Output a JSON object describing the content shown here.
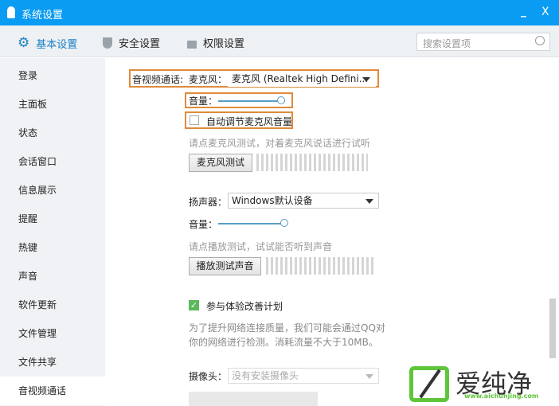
{
  "window": {
    "title": "系统设置",
    "minimize": "_",
    "close": "X"
  },
  "toolbar": {
    "tabs": [
      {
        "label": "基本设置",
        "icon": "gear-icon"
      },
      {
        "label": "安全设置",
        "icon": "shield-icon"
      },
      {
        "label": "权限设置",
        "icon": "lock-icon"
      }
    ],
    "search_placeholder": "搜索设置项"
  },
  "sidebar": {
    "items": [
      "登录",
      "主面板",
      "状态",
      "会话窗口",
      "信息展示",
      "提醒",
      "热键",
      "声音",
      "软件更新",
      "文件管理",
      "文件共享",
      "音视频通话"
    ],
    "selected": "音视频通话"
  },
  "content": {
    "section_label": "音视频通话:",
    "mic_label": "麦克风：",
    "mic_value": "麦克风 (Realtek High Defini...",
    "mic_volume_label": "音量：",
    "mic_volume": 0.85,
    "auto_adjust_label": "自动调节麦克风音量",
    "auto_adjust_checked": false,
    "mic_hint": "请点麦克风测试，对着麦克风说话进行试听",
    "mic_test_button": "麦克风测试",
    "speaker_label": "扬声器：",
    "speaker_value": "Windows默认设备",
    "speaker_volume_label": "音量：",
    "speaker_volume": 1.0,
    "speaker_hint": "请点播放测试，试试能否听到声音",
    "speaker_test_button": "播放测试声音",
    "improve_label": "参与体验改善计划",
    "improve_checked": true,
    "improve_desc1": "为了提升网络连接质量，我们可能会通过QQ对",
    "improve_desc2": "你的网络进行检测。消耗流量不大于10MB。",
    "camera_label": "摄像头：",
    "camera_value": "没有安装摄像头"
  },
  "watermark": {
    "text": "爱纯净",
    "url": "www.aichunjing.com"
  },
  "colors": {
    "titlebar": "#0a9bf2",
    "highlight": "#e08a3c",
    "check": "#5cb85c"
  }
}
